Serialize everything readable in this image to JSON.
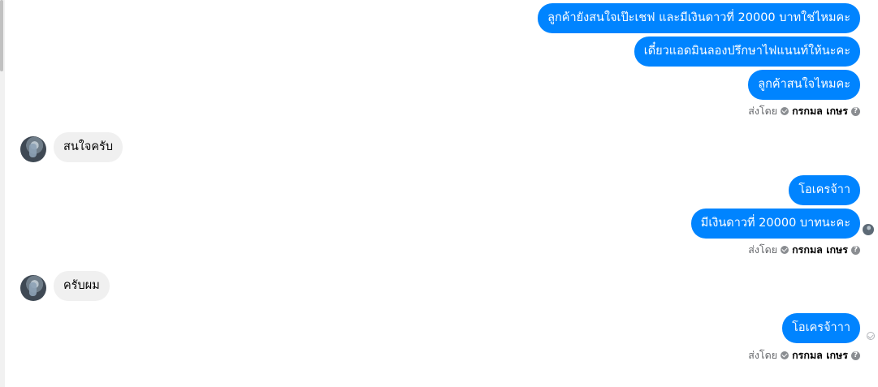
{
  "messages": {
    "out_1": "ลูกค้ายังสนใจเป๊ะเชฟ และมีเงินดาวที่ 20000 บาทใช่ไหมคะ",
    "out_2": "เดี๋ยวแอดมินลองปรึกษาไฟแนนท์ให้นะคะ",
    "out_3": "ลูกค้าสนใจไหมคะ",
    "in_1": "สนใจครับ",
    "out_4": "โอเครจ้าา",
    "out_5": "มีเงินดาวที่ 20000 บาทนะคะ",
    "in_2": "ครับผม",
    "out_6": "โอเครจ้าาา"
  },
  "sent_by": {
    "prefix": "ส่งโดย",
    "name": "กรกมล เกษร",
    "help": "?"
  },
  "colors": {
    "outgoing_bubble": "#0084ff",
    "incoming_bubble": "#f0f0f0",
    "meta_text": "#65676b"
  },
  "icons": {
    "verified": "check-circle-icon",
    "help": "question-circle-icon",
    "sent": "sent-check-icon",
    "seen": "seen-avatar"
  }
}
